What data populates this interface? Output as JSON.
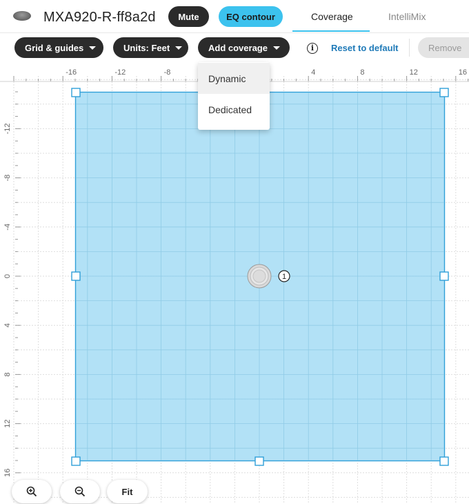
{
  "header": {
    "device_name": "MXA920-R-ff8a2d",
    "mute_label": "Mute",
    "eq_label": "EQ contour",
    "tabs": [
      {
        "label": "Coverage",
        "active": true
      },
      {
        "label": "IntelliMix",
        "active": false
      }
    ]
  },
  "toolbar": {
    "grid_label": "Grid & guides",
    "units_label": "Units: Feet",
    "add_label": "Add coverage",
    "info_icon": "info-icon",
    "reset_label": "Reset to default",
    "remove_label": "Remove"
  },
  "add_menu": {
    "items": [
      {
        "label": "Dynamic",
        "highlighted": true
      },
      {
        "label": "Dedicated",
        "highlighted": false
      }
    ]
  },
  "ruler": {
    "x_labels": [
      "-16",
      "-12",
      "-8",
      "4",
      "8",
      "12",
      "16"
    ],
    "y_labels": [
      "-12",
      "-8",
      "-4",
      "0",
      "4",
      "8",
      "12",
      "16"
    ]
  },
  "microphone": {
    "number": "1",
    "icon": "microphone-icon"
  },
  "colors": {
    "coverage_fill": "#aedff5",
    "coverage_stroke": "#2f9fd8",
    "accent": "#3cc2ee",
    "dark_button": "#2b2b2b",
    "link": "#1f7ab8"
  },
  "zoom": {
    "zoom_in_icon": "zoom-in-icon",
    "zoom_out_icon": "zoom-out-icon",
    "fit_label": "Fit"
  }
}
